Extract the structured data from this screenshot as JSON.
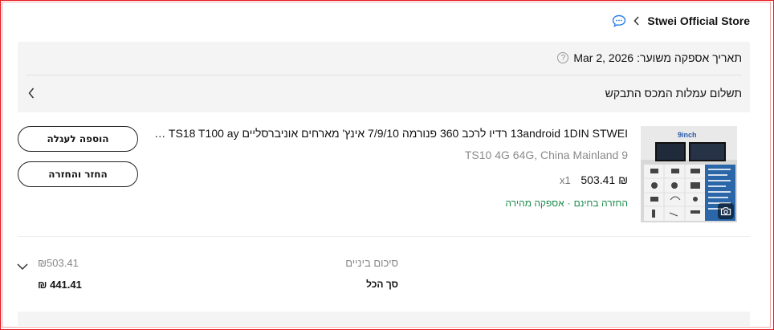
{
  "store": {
    "name": "Stwei Official Store",
    "chat_icon": "chat-bubble-icon",
    "back_icon": "chevron-left-icon"
  },
  "delivery": {
    "label": "תאריך אספקה משוער:",
    "date": "Mar 2, 2026",
    "info_icon": "question-circle-icon"
  },
  "customs": {
    "label": "תשלום עמלות המכס התבקש",
    "chevron_icon": "chevron-left-icon"
  },
  "product": {
    "title": "13android 1DIN STWEI רדיו לרכב 360 פנורמה 7/9/10 אינץ' מארחים אוניברסליים TS10 TS18 T100 ay...",
    "variant": "9 TS10 4G 64G, China Mainland",
    "price": "503.41 ₪",
    "quantity": "x1",
    "tag_return": "החזרה בחינם",
    "tag_sep": "·",
    "tag_shipping": "אספקה מהירה",
    "image_label": "9inch",
    "camera_icon": "camera-icon"
  },
  "actions": {
    "add_to_cart": "הוספה לעגלה",
    "return": "החזר והחזרה"
  },
  "summary": {
    "subtotal_label": "סיכום ביניים",
    "subtotal_value": "₪503.41",
    "total_label": "סך הכל",
    "total_value": "₪ 441.41",
    "expand_icon": "chevron-down-icon"
  },
  "colors": {
    "frame_border": "#e6191f",
    "info_bg": "#f4f4f4",
    "tag_green": "#1a8a4a",
    "chat_blue": "#2b7de9"
  }
}
